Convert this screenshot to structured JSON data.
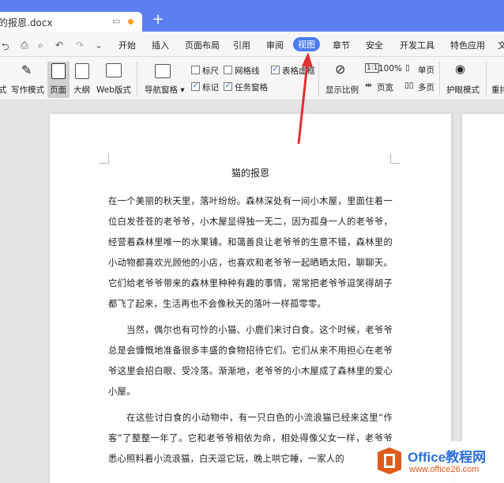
{
  "tab": {
    "filename": "猫的报恩.docx",
    "new_tab": "+"
  },
  "quick_access": {
    "icons": [
      "share-icon",
      "print-icon",
      "print-preview-icon",
      "undo-icon",
      "redo-icon",
      "more-icon"
    ]
  },
  "menu": {
    "items": [
      "开始",
      "插入",
      "页面布局",
      "引用",
      "审阅",
      "视图",
      "章节",
      "安全",
      "开发工具",
      "特色应用",
      "文"
    ],
    "active": "视图"
  },
  "ribbon": {
    "views": [
      "式",
      "写作模式",
      "页面",
      "大纲",
      "Web版式"
    ],
    "nav_pane": "导航窗格",
    "checkboxes": [
      {
        "label": "标尺",
        "checked": false
      },
      {
        "label": "网格线",
        "checked": false
      },
      {
        "label": "表格虚框",
        "checked": true
      },
      {
        "label": "标记",
        "checked": true
      },
      {
        "label": "任务窗格",
        "checked": true
      }
    ],
    "zoom_label": "显示比例",
    "zoom_100": "100%",
    "page_width": "页宽",
    "single_page": "单页",
    "multi_page": "多页",
    "eye_protect": "护眼模式",
    "rearrange": "重排"
  },
  "document": {
    "title": "猫的报恩",
    "paragraphs": [
      "在一个美丽的秋天里，落叶纷纷。森林深处有一间小木屋，里面住着一位白发苍苍的老爷爷，小木屋显得独一无二，因为孤身一人的老爷爷，经营着森林里唯一的水果铺。和蔼善良让老爷爷的生意不错，森林里的小动物都喜欢光顾他的小店，也喜欢和老爷爷一起晒晒太阳，聊聊天。它们给老爷爷带来的森林里种种有趣的事情，常常把老爷爷逗笑得胡子都飞了起来，生活再也不会像秋天的落叶一样孤零零。",
      "当然，偶尔也有可怜的小猫、小鹿们来讨白食。这个时候，老爷爷总是会慷慨地准备很多丰盛的食物招待它们。它们从来不用担心在老爷爷这里会招白眼、受冷落。渐渐地，老爷爷的小木屋成了森林里的爱心小屋。",
      "在这些讨白食的小动物中，有一只白色的小流浪猫已经来这里“作客”了整整一年了。它和老爷爷相依为命，相处得像父女一样，老爷爷悉心照料着小流浪猫，白天逗它玩，晚上哄它睡，一家人的"
    ]
  },
  "watermark": {
    "brand": "Office教程网",
    "url": "www.office26.com"
  }
}
